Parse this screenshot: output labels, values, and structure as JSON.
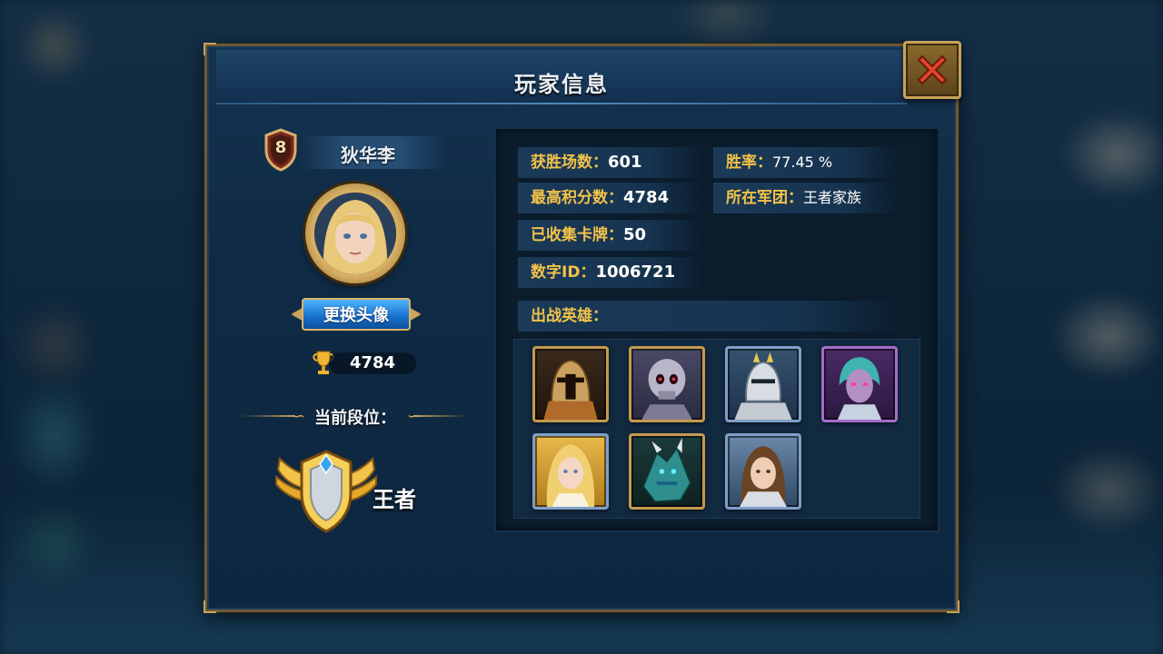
{
  "dialog": {
    "title": "玩家信息"
  },
  "profile": {
    "level": "8",
    "name": "狄华李",
    "change_avatar_label": "更换头像",
    "trophies": "4784",
    "rank_heading": "当前段位：",
    "rank_name": "王者"
  },
  "stats": {
    "wins_label": "获胜场数：",
    "wins_value": "601",
    "win_rate_label": "胜率：",
    "win_rate_value": "77.45 %",
    "high_score_label": "最高积分数：",
    "high_score_value": "4784",
    "legion_label": "所在军团：",
    "legion_value": "王者家族",
    "cards_label": "已收集卡牌：",
    "cards_value": "50",
    "id_label": "数字ID：",
    "id_value": "1006721",
    "heroes_label": "出战英雄："
  },
  "heroes": [
    {
      "name": "spartan-knight",
      "frame": "gold"
    },
    {
      "name": "skull-warrior",
      "frame": "gold"
    },
    {
      "name": "silver-knight",
      "frame": "blue"
    },
    {
      "name": "purple-sorceress",
      "frame": "purple"
    },
    {
      "name": "golden-maiden",
      "frame": "blue"
    },
    {
      "name": "teal-dragon",
      "frame": "gold"
    },
    {
      "name": "brunette-paladin",
      "frame": "blue"
    }
  ],
  "colors": {
    "accent_gold": "#f2c24a",
    "button_blue": "#1b74d0",
    "close_red": "#e2462c"
  },
  "icons": {
    "close": "close-icon",
    "trophy": "trophy-icon",
    "level_shield": "level-shield-icon",
    "rank_emblem": "king-rank-emblem-icon"
  }
}
